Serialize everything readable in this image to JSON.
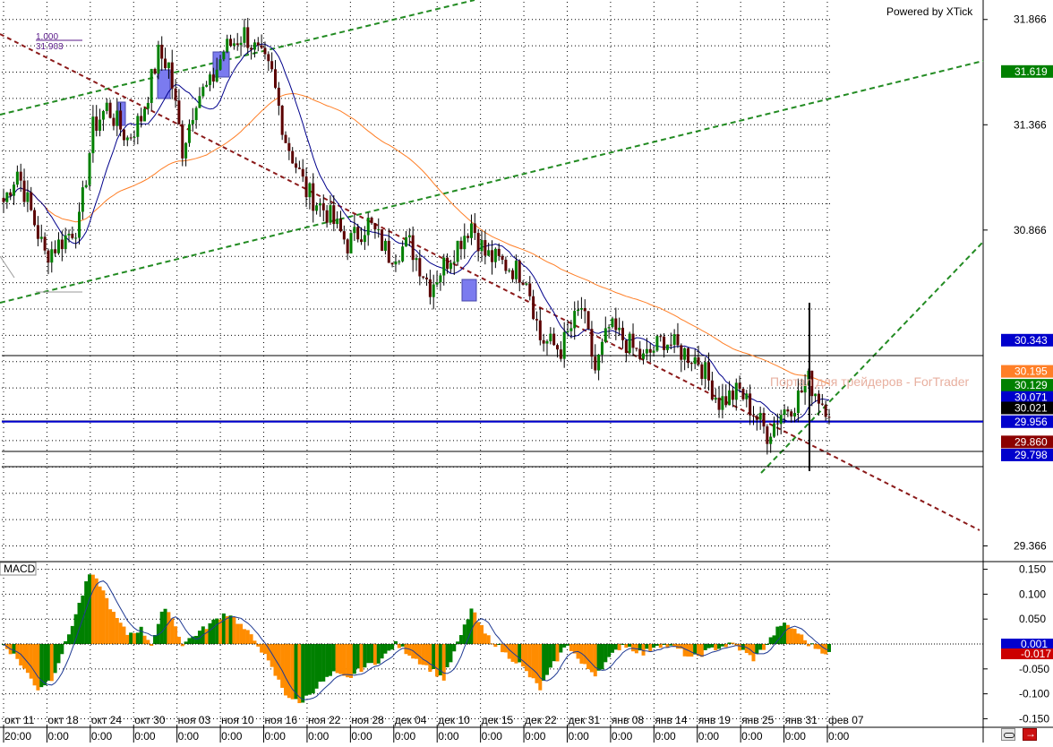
{
  "header": {
    "powered_by": "Powered by XTick"
  },
  "watermark": "Портал для трейдеров - ForTrader",
  "fib_label": {
    "level": "1.000",
    "price": "31.903"
  },
  "indicator_label": "MACD",
  "colors": {
    "bull_candle": "#008000",
    "bear_candle": "#5b0000",
    "grid": "#000000",
    "fast_ma": "#00008b",
    "slow_ma": "#ff7f27",
    "channel": "#228b22",
    "trend": "#8b1a1a",
    "macd_pos_up": "#008000",
    "macd_neg": "#ff8c00",
    "macd_signal": "#1f3a93",
    "support_line": "#0000cd"
  },
  "chart_data": [
    {
      "type": "candlestick",
      "title": "",
      "ylim": [
        29.3,
        31.95
      ],
      "y_ticks": [
        "31.866",
        "31.366",
        "30.866",
        "29.366"
      ],
      "price_tags": [
        {
          "value": 31.619,
          "label": "31.619",
          "bg": "#008000",
          "fg": "#ffffff"
        },
        {
          "value": 30.343,
          "label": "30.343",
          "bg": "#0000cc",
          "fg": "#ffffff"
        },
        {
          "value": 30.195,
          "label": "30.195",
          "bg": "#ff7f27",
          "fg": "#ffffff"
        },
        {
          "value": 30.129,
          "label": "30.129",
          "bg": "#008000",
          "fg": "#ffffff"
        },
        {
          "value": 30.071,
          "label": "30.071",
          "bg": "#0000cc",
          "fg": "#ffffff"
        },
        {
          "value": 30.021,
          "label": "30.021",
          "bg": "#000000",
          "fg": "#ffffff",
          "marker": "▼"
        },
        {
          "value": 29.956,
          "label": "29.956",
          "bg": "#0000cc",
          "fg": "#ffffff"
        },
        {
          "value": 29.86,
          "label": "29.860",
          "bg": "#8b0000",
          "fg": "#ffffff"
        },
        {
          "value": 29.798,
          "label": "29.798",
          "bg": "#0000cc",
          "fg": "#ffffff"
        }
      ],
      "x_labels": [
        "окт 11",
        "окт 18",
        "окт 24",
        "окт 30",
        "ноя 03",
        "ноя 10",
        "ноя 16",
        "ноя 22",
        "ноя 28",
        "дек 04",
        "дек 10",
        "дек 15",
        "дек 22",
        "дек 31",
        "янв 08",
        "янв 14",
        "янв 19",
        "янв 25",
        "янв 31",
        "фев 07"
      ],
      "x_time_labels": [
        "20:00",
        "0:00",
        "0:00",
        "0:00",
        "0:00",
        "0:00",
        "0:00",
        "0:00",
        "0:00",
        "0:00",
        "0:00",
        "0:00",
        "0:00",
        "0:00",
        "0:00",
        "0:00",
        "0:00",
        "0:00",
        "0:00",
        "0:00"
      ],
      "close_anchors": [
        [
          0,
          31.0
        ],
        [
          4,
          31.15
        ],
        [
          9,
          30.9
        ],
        [
          12,
          30.75
        ],
        [
          16,
          30.8
        ],
        [
          22,
          30.9
        ],
        [
          26,
          31.35
        ],
        [
          30,
          31.45
        ],
        [
          36,
          31.3
        ],
        [
          40,
          31.4
        ],
        [
          45,
          31.7
        ],
        [
          48,
          31.65
        ],
        [
          52,
          31.25
        ],
        [
          56,
          31.5
        ],
        [
          60,
          31.55
        ],
        [
          64,
          31.72
        ],
        [
          70,
          31.8
        ],
        [
          74,
          31.7
        ],
        [
          78,
          31.6
        ],
        [
          82,
          31.3
        ],
        [
          88,
          31.05
        ],
        [
          94,
          30.95
        ],
        [
          100,
          30.8
        ],
        [
          106,
          30.9
        ],
        [
          112,
          30.75
        ],
        [
          118,
          30.8
        ],
        [
          124,
          30.6
        ],
        [
          130,
          30.75
        ],
        [
          136,
          30.9
        ],
        [
          140,
          30.75
        ],
        [
          146,
          30.7
        ],
        [
          152,
          30.65
        ],
        [
          156,
          30.35
        ],
        [
          162,
          30.3
        ],
        [
          168,
          30.5
        ],
        [
          172,
          30.2
        ],
        [
          176,
          30.4
        ],
        [
          180,
          30.35
        ],
        [
          186,
          30.25
        ],
        [
          192,
          30.35
        ],
        [
          196,
          30.3
        ],
        [
          202,
          30.25
        ],
        [
          208,
          30.05
        ],
        [
          214,
          30.1
        ],
        [
          218,
          30.0
        ],
        [
          222,
          29.9
        ],
        [
          226,
          30.0
        ],
        [
          230,
          30.05
        ],
        [
          234,
          30.15
        ],
        [
          238,
          30.05
        ],
        [
          240,
          30.02
        ]
      ],
      "support_level": 29.956
    },
    {
      "type": "bar",
      "title": "MACD",
      "ylim": [
        -0.16,
        0.16
      ],
      "y_ticks": [
        "0.150",
        "0.100",
        "0.050",
        "-0.050",
        "-0.100",
        "-0.150"
      ],
      "value_tags": [
        {
          "value": 0.001,
          "label": "0.001",
          "bg": "#0000cc",
          "fg": "#ffffff"
        },
        {
          "value": -0.017,
          "label": "-0.017",
          "bg": "#cc0000",
          "fg": "#ffffff"
        }
      ],
      "hist_anchors": [
        [
          0,
          0.0
        ],
        [
          4,
          -0.03
        ],
        [
          10,
          -0.09
        ],
        [
          14,
          -0.07
        ],
        [
          18,
          0.0
        ],
        [
          22,
          0.08
        ],
        [
          25,
          0.14
        ],
        [
          28,
          0.12
        ],
        [
          32,
          0.06
        ],
        [
          36,
          0.02
        ],
        [
          40,
          0.03
        ],
        [
          43,
          0.0
        ],
        [
          46,
          0.06
        ],
        [
          48,
          0.07
        ],
        [
          52,
          0.0
        ],
        [
          56,
          0.02
        ],
        [
          60,
          0.04
        ],
        [
          64,
          0.06
        ],
        [
          66,
          0.06
        ],
        [
          70,
          0.03
        ],
        [
          74,
          0.0
        ],
        [
          78,
          -0.05
        ],
        [
          82,
          -0.1
        ],
        [
          86,
          -0.12
        ],
        [
          92,
          -0.08
        ],
        [
          96,
          -0.06
        ],
        [
          100,
          -0.07
        ],
        [
          104,
          -0.05
        ],
        [
          110,
          -0.03
        ],
        [
          114,
          0.0
        ],
        [
          118,
          -0.02
        ],
        [
          124,
          -0.05
        ],
        [
          128,
          -0.07
        ],
        [
          132,
          0.0
        ],
        [
          136,
          0.07
        ],
        [
          140,
          0.02
        ],
        [
          146,
          -0.02
        ],
        [
          150,
          -0.04
        ],
        [
          156,
          -0.09
        ],
        [
          160,
          -0.04
        ],
        [
          164,
          0.0
        ],
        [
          168,
          -0.04
        ],
        [
          172,
          -0.06
        ],
        [
          176,
          -0.03
        ],
        [
          180,
          0.0
        ],
        [
          186,
          -0.02
        ],
        [
          190,
          0.0
        ],
        [
          196,
          -0.01
        ],
        [
          200,
          -0.03
        ],
        [
          206,
          -0.01
        ],
        [
          212,
          0.0
        ],
        [
          218,
          -0.03
        ],
        [
          222,
          0.0
        ],
        [
          226,
          0.04
        ],
        [
          230,
          0.03
        ],
        [
          234,
          0.0
        ],
        [
          240,
          -0.02
        ]
      ]
    }
  ]
}
